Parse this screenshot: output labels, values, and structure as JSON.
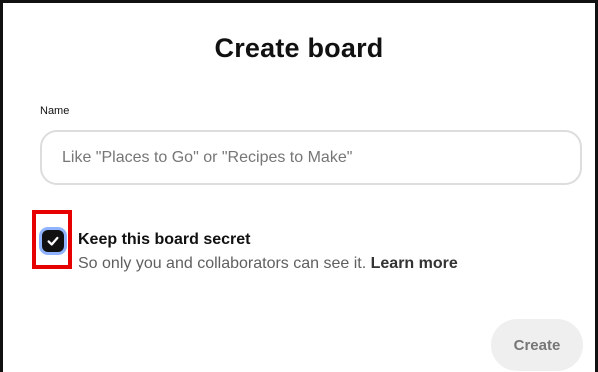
{
  "dialog": {
    "title": "Create board",
    "name_field": {
      "label": "Name",
      "value": "",
      "placeholder": "Like \"Places to Go\" or \"Recipes to Make\""
    },
    "secret_option": {
      "checked": true,
      "title": "Keep this board secret",
      "description": "So only you and collaborators can see it.",
      "learn_more_label": "Learn more"
    },
    "create_button_label": "Create"
  },
  "icons": {
    "checkbox_mark": "check-icon"
  },
  "colors": {
    "highlight_border": "#e60000",
    "checkbox_fill": "#111111",
    "focus_ring": "#8fb3ff",
    "button_bg": "#efefef",
    "button_text": "#767676"
  }
}
